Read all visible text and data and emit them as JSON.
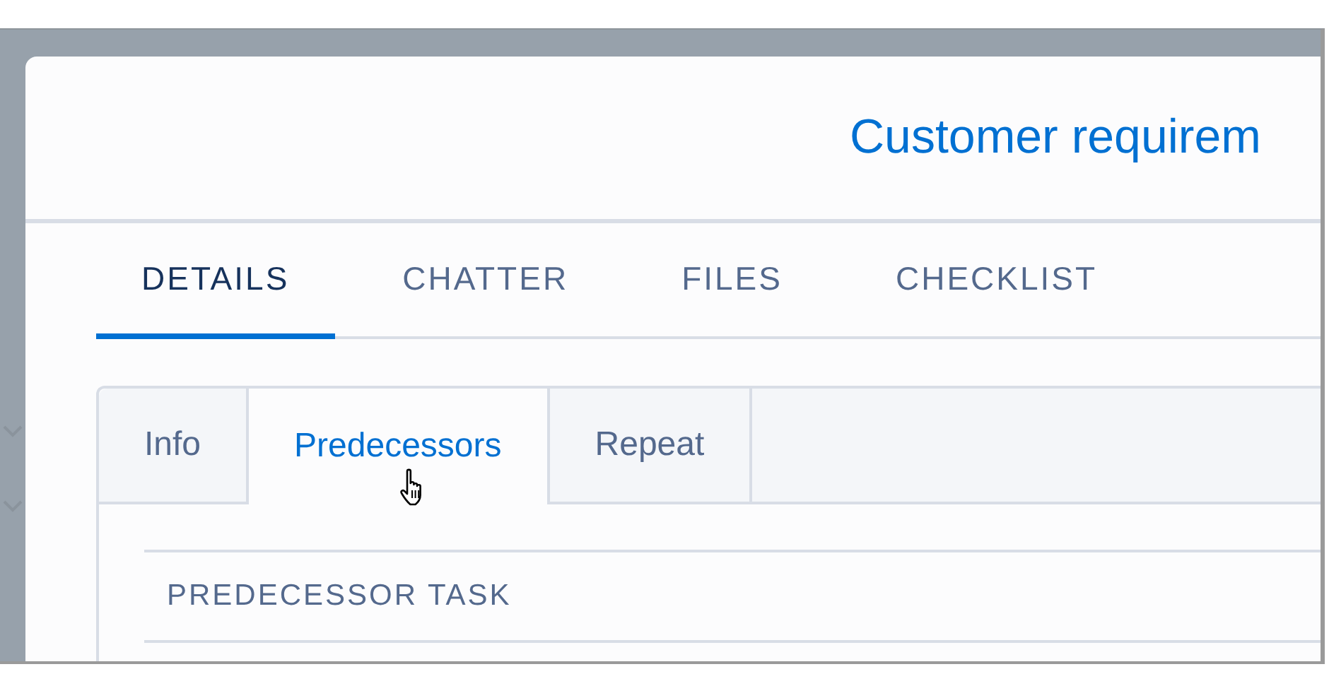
{
  "header": {
    "title": "Customer requirem"
  },
  "tabs": [
    {
      "label": "DETAILS",
      "selected": true
    },
    {
      "label": "CHATTER",
      "selected": false
    },
    {
      "label": "FILES",
      "selected": false
    },
    {
      "label": "CHECKLIST",
      "selected": false
    }
  ],
  "subtabs": [
    {
      "label": "Info",
      "selected": false
    },
    {
      "label": "Predecessors",
      "selected": true
    },
    {
      "label": "Repeat",
      "selected": false
    }
  ],
  "section": {
    "heading": "PREDECESSOR TASK"
  }
}
